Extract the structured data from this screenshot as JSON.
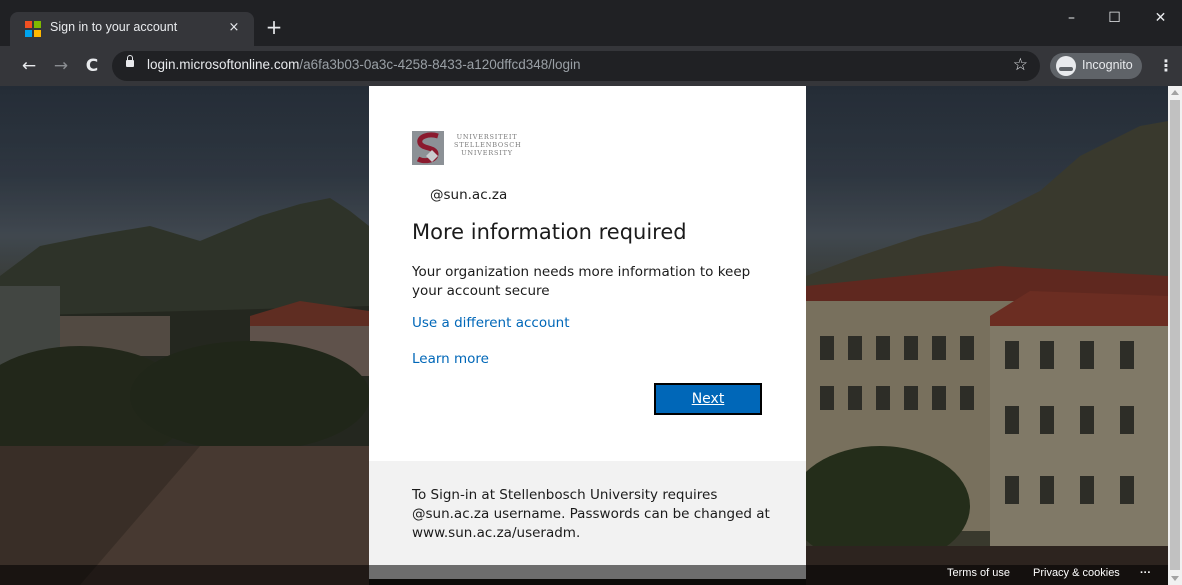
{
  "browser": {
    "tab_title": "Sign in to your account",
    "tab_close": "×",
    "new_tab": "+",
    "url_host": "login.microsoftonline.com",
    "url_path": "/a6fa3b03-0a3c-4258-8433-a120dffcd348/login",
    "incognito_label": "Incognito",
    "minimize": "–",
    "maximize": "☐",
    "close": "✕",
    "back": "←",
    "forward": "→",
    "reload": "C",
    "bookmark": "☆",
    "menu": "⋮"
  },
  "signin": {
    "logo_lines": [
      "UNIVERSITEIT",
      "STELLENBOSCH",
      "UNIVERSITY"
    ],
    "username": "@sun.ac.za",
    "heading": "More information required",
    "description": "Your organization needs more information to keep your account secure",
    "use_different": "Use a different account",
    "learn_more": "Learn more",
    "next": "Next",
    "note": "To Sign-in at Stellenbosch University requires @sun.ac.za username. Passwords can be changed at www.sun.ac.za/useradm."
  },
  "footer": {
    "terms": "Terms of use",
    "privacy": "Privacy & cookies",
    "more": "···"
  },
  "colors": {
    "accent": "#0067b8",
    "chrome_dark": "#202124",
    "chrome_toolbar": "#35363a",
    "logo_red": "#8b1a2e"
  },
  "icons": {
    "favicon": "microsoft-logo-icon",
    "lock": "lock-icon",
    "incognito": "incognito-icon"
  }
}
